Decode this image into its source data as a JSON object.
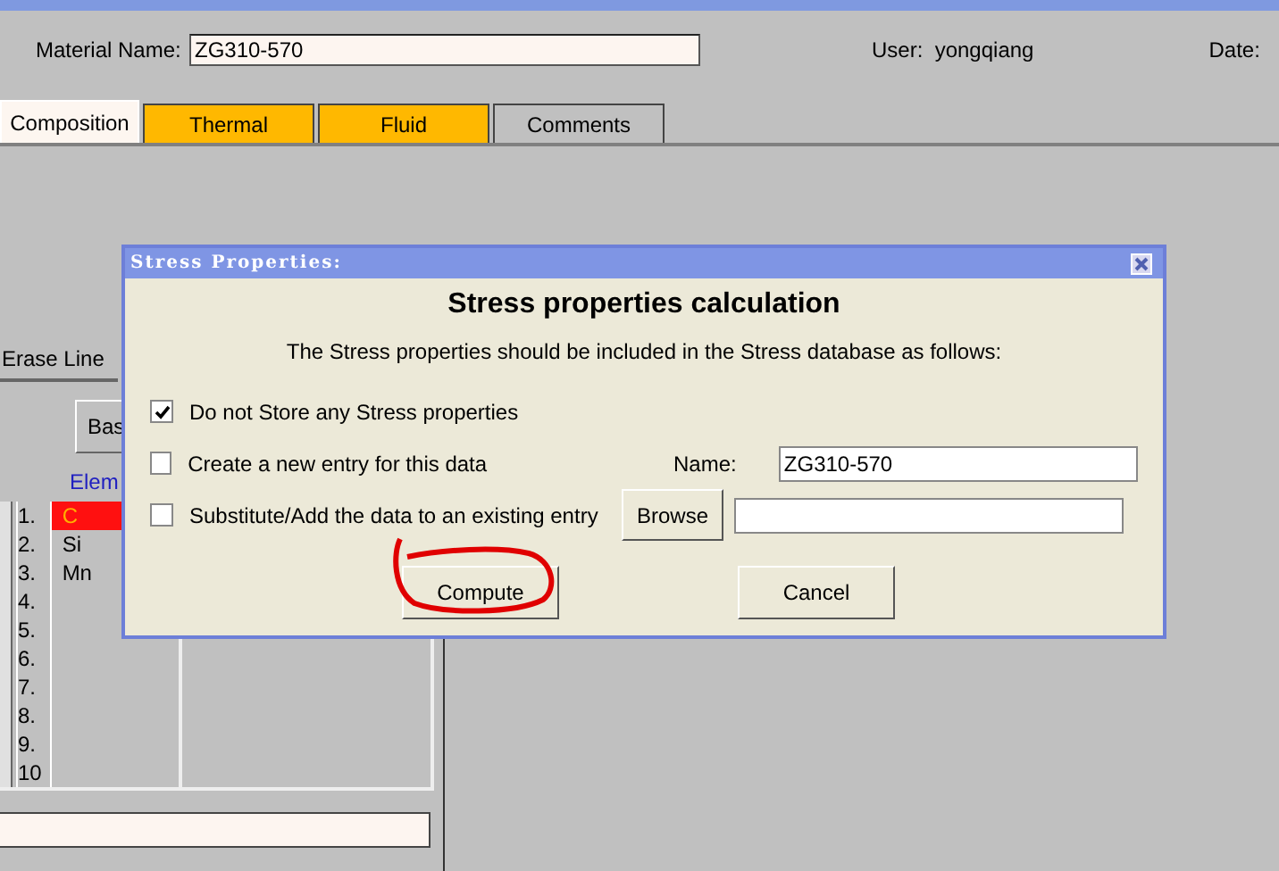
{
  "header": {
    "material_label": "Material Name:",
    "material_value": "ZG310-570",
    "user_label": "User:",
    "user_value": "yongqiang",
    "date_label": "Date:"
  },
  "tabs": [
    {
      "label": "Composition",
      "selected": true,
      "color": "#fdf6f0"
    },
    {
      "label": "Thermal",
      "selected": false,
      "color": "#ffb800"
    },
    {
      "label": "Fluid",
      "selected": false,
      "color": "#ffb800"
    },
    {
      "label": "Comments",
      "selected": false,
      "color": "#c0c0c0"
    }
  ],
  "left_panel": {
    "erase_button": "Erase Line",
    "base_button": "Bas",
    "elements_heading": "Elem",
    "row_numbers": [
      "1.",
      "2.",
      "3.",
      "4.",
      "5.",
      "6.",
      "7.",
      "8.",
      "9.",
      "10"
    ],
    "elements": [
      {
        "symbol": "C",
        "selected": true
      },
      {
        "symbol": "Si",
        "selected": false
      },
      {
        "symbol": "Mn",
        "selected": false
      }
    ]
  },
  "dialog": {
    "title": "Stress Properties:",
    "heading": "Stress properties calculation",
    "intro": "The Stress properties should be included in the Stress database as follows:",
    "options": [
      {
        "label": "Do not Store any Stress properties",
        "checked": true
      },
      {
        "label": "Create a new entry for this data",
        "checked": false
      },
      {
        "label": "Substitute/Add the data to an existing entry",
        "checked": false
      }
    ],
    "name_label": "Name:",
    "name_value": "ZG310-570",
    "browse_button": "Browse",
    "buttons": [
      "Compute",
      "Cancel"
    ]
  }
}
